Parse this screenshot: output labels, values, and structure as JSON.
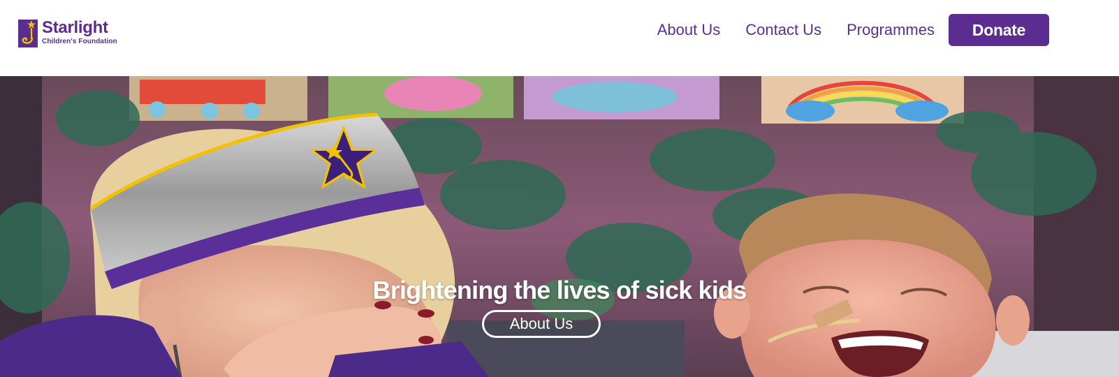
{
  "header": {
    "logo": {
      "name": "Starlight",
      "subtitle": "Children's Foundation"
    },
    "nav": {
      "items": [
        {
          "label": "About Us"
        },
        {
          "label": "Contact Us"
        },
        {
          "label": "Programmes"
        }
      ],
      "donate_label": "Donate"
    }
  },
  "hero": {
    "headline": "Brightening the lives of sick kids",
    "cta_label": "About Us",
    "image_description_icon": "hero-photo"
  },
  "colors": {
    "brand_purple": "#5b2d91",
    "brand_yellow": "#f5c400",
    "white": "#ffffff"
  }
}
